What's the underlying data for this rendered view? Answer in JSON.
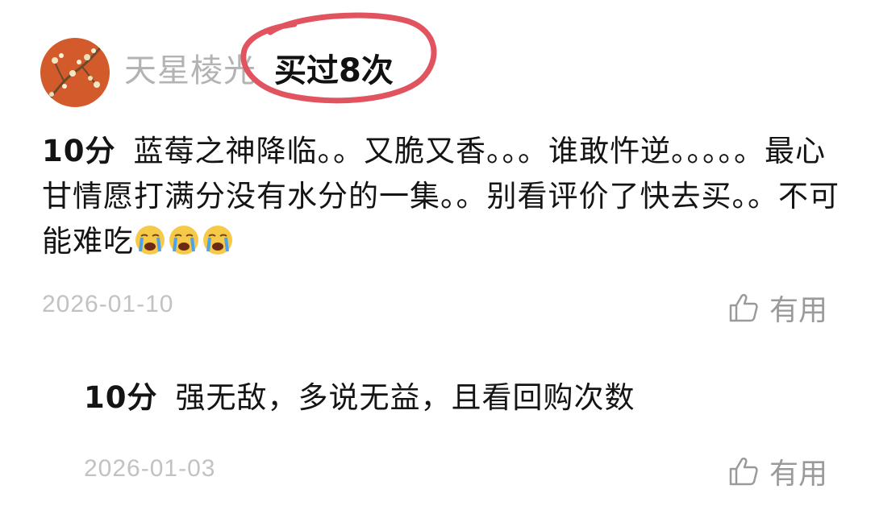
{
  "review": {
    "username": "天星棱光",
    "purchase_badge": "买过8次",
    "main": {
      "score": "10分",
      "text": "蓝莓之神降临。。又脆又香。。。谁敢忤逆。。。。。最心甘情愿打满分没有水分的一集。。别看评价了快去买。。不可能难吃",
      "emoji_count": 3,
      "emoji_name": "loudly-crying-face",
      "date": "2026-01-10",
      "helpful_label": "有用"
    },
    "followup": {
      "score": "10分",
      "text": "强无敌，多说无益，且看回购次数",
      "date": "2026-01-03",
      "helpful_label": "有用"
    }
  },
  "colors": {
    "highlight_ring": "#e0535f",
    "muted_text": "#b3b3b3",
    "date_text": "#c2c2c2",
    "helpful_text": "#9a9a9a",
    "avatar_bg": "#d9572c"
  },
  "icons": {
    "helpful": "thumbs-up-icon",
    "emoji": "crying-face-emoji"
  }
}
